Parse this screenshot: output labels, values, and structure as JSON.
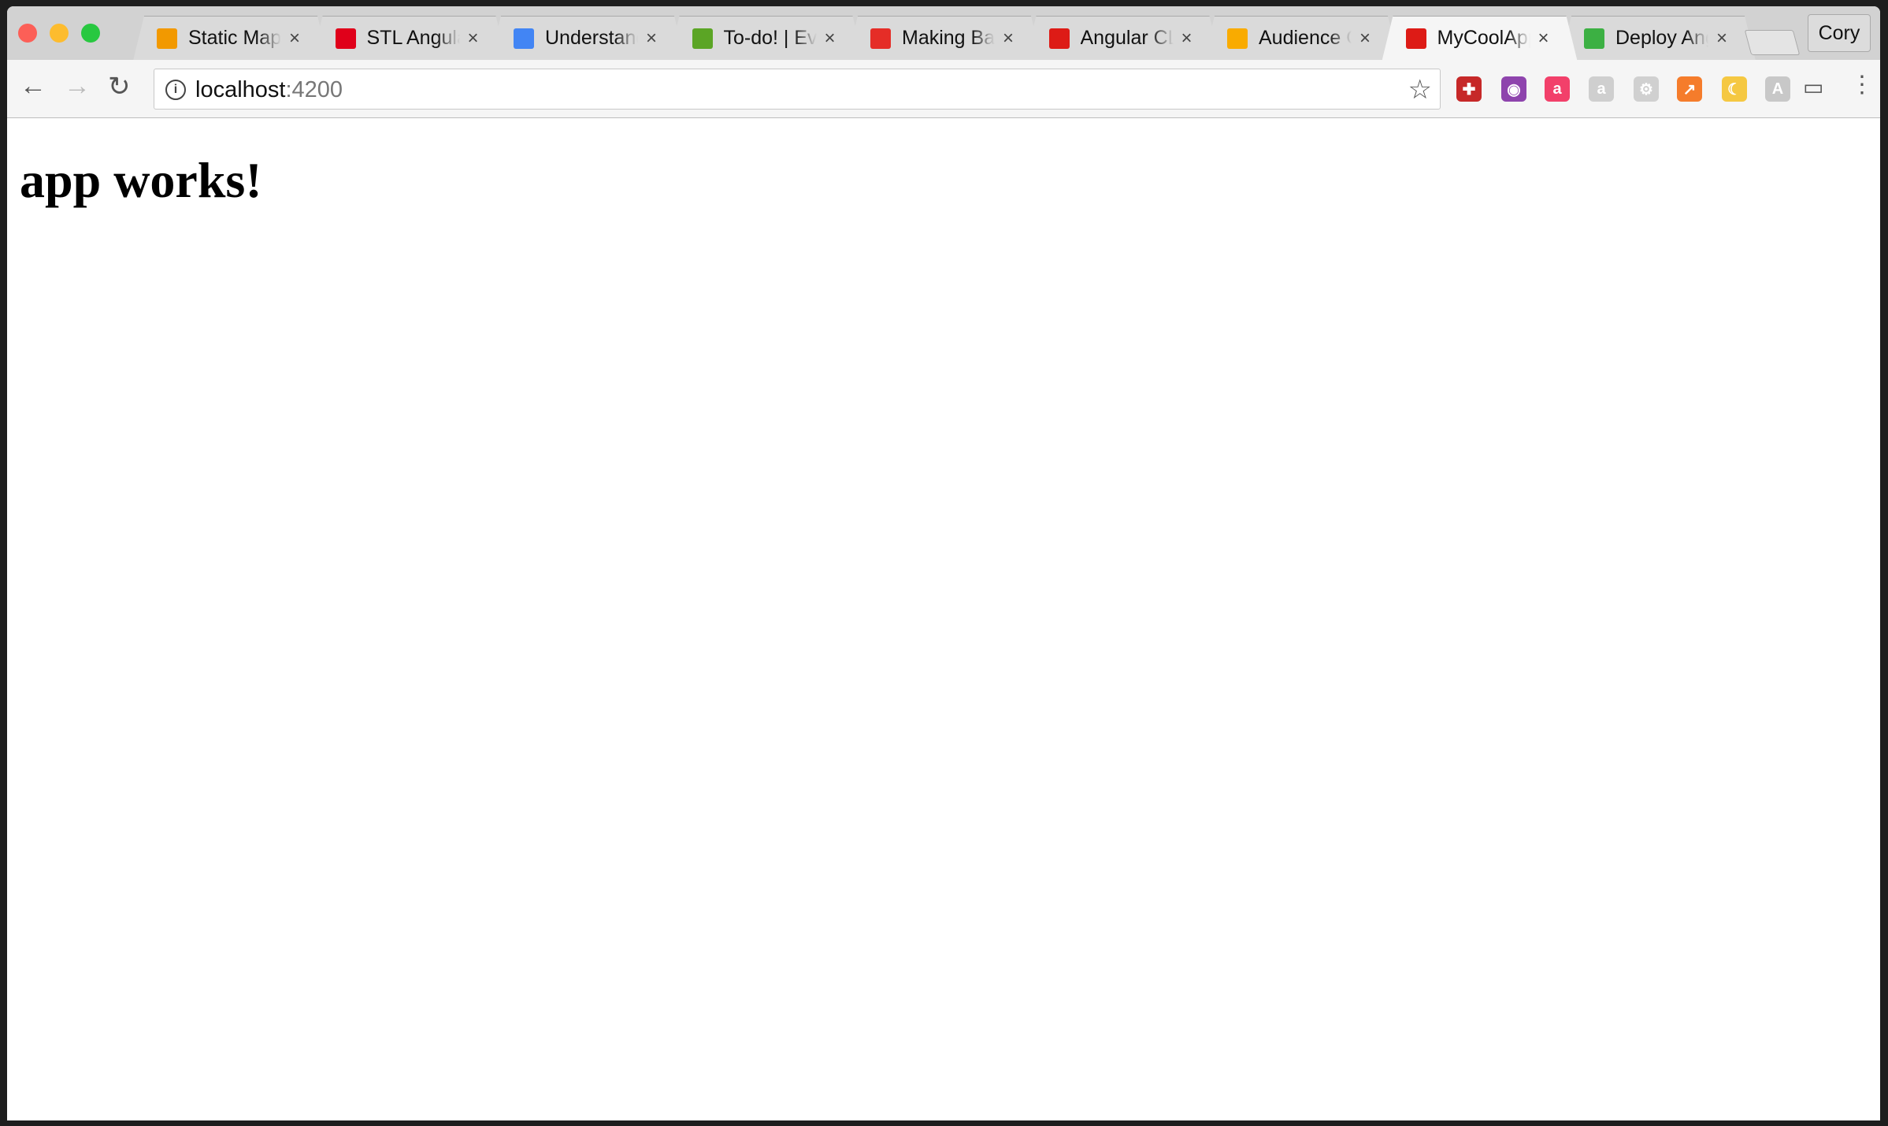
{
  "browser": {
    "tabs": [
      {
        "title": "Static Map",
        "icon": "map-pin-icon",
        "color": "#f29900"
      },
      {
        "title": "STL Angular",
        "icon": "meetup-icon",
        "color": "#e0001a"
      },
      {
        "title": "Understanding",
        "icon": "google-docs-icon",
        "color": "#4285f4"
      },
      {
        "title": "To-do! | Evernote",
        "icon": "evernote-icon",
        "color": "#5ba525"
      },
      {
        "title": "Making Backends",
        "icon": "youtube-icon",
        "color": "#e52d27"
      },
      {
        "title": "Angular CLI",
        "icon": "angular-icon",
        "color": "#dd1b16"
      },
      {
        "title": "Audience Overview",
        "icon": "analytics-icon",
        "color": "#f9ab00"
      },
      {
        "title": "MyCoolApp",
        "icon": "angular-icon",
        "color": "#dd1b16",
        "active": true
      },
      {
        "title": "Deploy Angular",
        "icon": "deploy-icon",
        "color": "#3cb043"
      }
    ],
    "close_glyph": "×",
    "profile": "Cory",
    "url_host": "localhost",
    "url_port": ":4200",
    "extensions": [
      {
        "name": "clock-extension-icon",
        "color": "#c62828",
        "glyph": "✚"
      },
      {
        "name": "color-picker-extension-icon",
        "color": "#8e44ad",
        "glyph": "◉"
      },
      {
        "name": "chat-extension-icon",
        "color": "#f2406a",
        "glyph": "a"
      },
      {
        "name": "chat-disabled-extension-icon",
        "color": "#cfcfcf",
        "glyph": "a"
      },
      {
        "name": "settings-extension-icon",
        "color": "#d0d0d0",
        "glyph": "⚙"
      },
      {
        "name": "chart-extension-icon",
        "color": "#f57c2b",
        "glyph": "↗"
      },
      {
        "name": "night-mode-extension-icon",
        "color": "#f5c842",
        "glyph": "☾"
      },
      {
        "name": "angular-augury-extension-icon",
        "color": "#c8c8c8",
        "glyph": "A"
      }
    ]
  },
  "page": {
    "heading": "app works!"
  }
}
